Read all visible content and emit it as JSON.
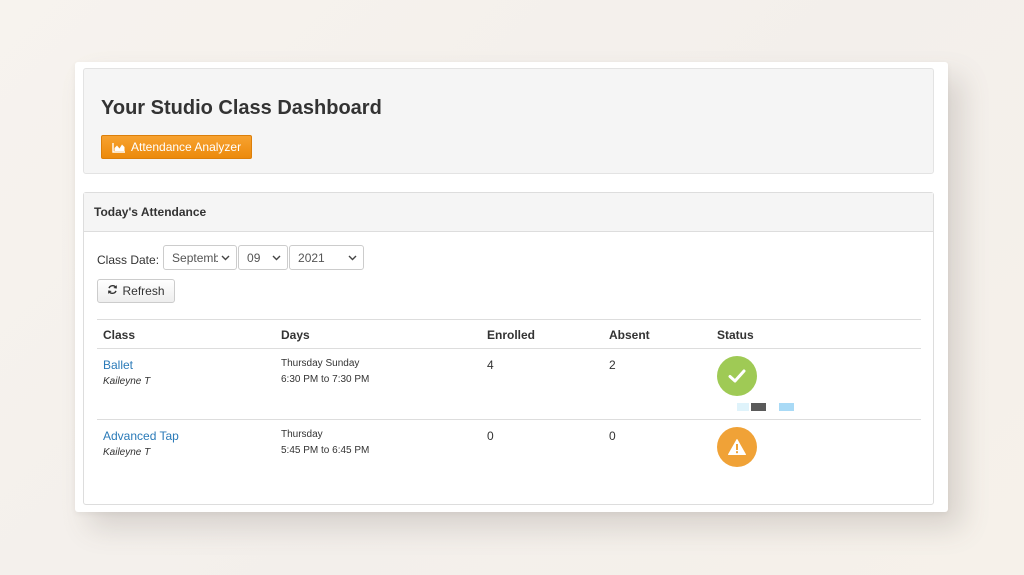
{
  "header": {
    "title": "Your Studio Class Dashboard",
    "analyzer_button": "Attendance Analyzer"
  },
  "panel": {
    "heading": "Today's Attendance",
    "date_label": "Class Date:",
    "month": "September",
    "day": "09",
    "year": "2021",
    "refresh_button": "Refresh"
  },
  "table": {
    "columns": [
      "Class",
      "Days",
      "Enrolled",
      "Absent",
      "Status"
    ],
    "rows": [
      {
        "class": "Ballet",
        "instructor": "Kaileyne T",
        "days": "Thursday Sunday",
        "time": "6:30 PM to 7:30 PM",
        "enrolled": "4",
        "absent": "2",
        "status": "check-icon"
      },
      {
        "class": "Advanced Tap",
        "instructor": "Kaileyne T",
        "days": "Thursday",
        "time": "5:45 PM to 6:45 PM",
        "enrolled": "0",
        "absent": "0",
        "status": "warning-icon"
      }
    ]
  },
  "colors": {
    "accent_orange": "#ec8a0c",
    "link_blue": "#2a7ab8",
    "status_ok": "#9fca55",
    "status_warn": "#f0a237"
  }
}
